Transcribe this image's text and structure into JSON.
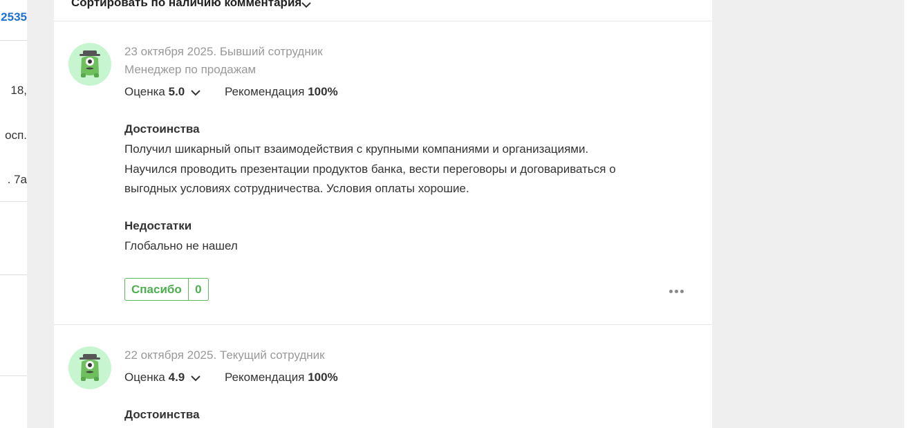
{
  "sidebar": {
    "texts": [
      "2535",
      "18,",
      "осп.",
      ". 7а"
    ]
  },
  "sort": {
    "label": "Сортировать по наличию комментария"
  },
  "reviews": [
    {
      "date_status": "23 октября 2025. Бывший сотрудник",
      "position": "Менеджер по продажам",
      "rating_label": "Оценка",
      "rating_value": "5.0",
      "rec_label": "Рекомендация",
      "rec_value": "100%",
      "pros_title": "Достоинства",
      "pros_text": "Получил шикарный опыт взаимодействия с крупными компаниями и организациями. Научился проводить презентации продуктов банка, вести переговоры и договариваться о выгодных условиях сотрудничества. Условия оплаты хорошие.",
      "cons_title": "Недостатки",
      "cons_text": "Глобально не нашел",
      "thanks_label": "Спасибо",
      "thanks_count": "0"
    },
    {
      "date_status": "22 октября 2025. Текущий сотрудник",
      "rating_label": "Оценка",
      "rating_value": "4.9",
      "rec_label": "Рекомендация",
      "rec_value": "100%",
      "pros_title": "Достоинства"
    }
  ],
  "colors": {
    "accent_green": "#4caf50",
    "avatar_bg": "#c6f5cf",
    "link_blue": "#1a6fd0"
  },
  "icons": [
    "chevron-down-icon",
    "avatar-monster-icon",
    "more-dots-icon"
  ]
}
